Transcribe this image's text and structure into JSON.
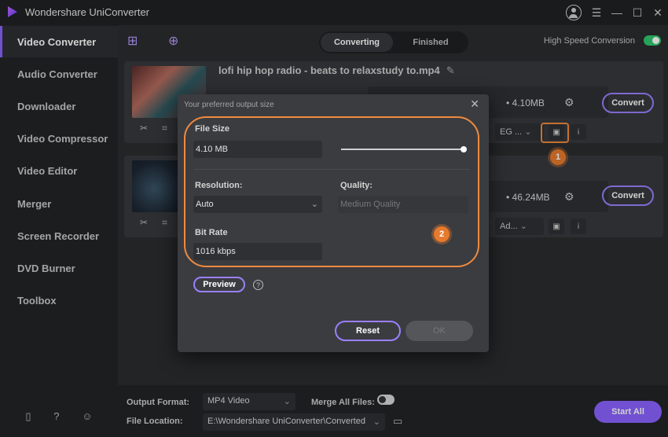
{
  "app": {
    "title": "Wondershare UniConverter"
  },
  "sidebar": {
    "items": [
      {
        "label": "Video Converter"
      },
      {
        "label": "Audio Converter"
      },
      {
        "label": "Downloader"
      },
      {
        "label": "Video Compressor"
      },
      {
        "label": "Video Editor"
      },
      {
        "label": "Merger"
      },
      {
        "label": "Screen Recorder"
      },
      {
        "label": "DVD Burner"
      },
      {
        "label": "Toolbox"
      }
    ]
  },
  "toolbar": {
    "tabs": [
      {
        "label": "Converting"
      },
      {
        "label": "Finished"
      }
    ],
    "high_speed_label": "High Speed Conversion"
  },
  "files": [
    {
      "title": "lofi hip hop radio - beats to relaxstudy to.mp4",
      "size": "• 4.10MB",
      "format": "EG ...",
      "convert_label": "Convert"
    },
    {
      "size": "• 46.24MB",
      "format": "Ad...",
      "convert_label": "Convert"
    }
  ],
  "dialog": {
    "title": "Your preferred output size",
    "file_size_label": "File Size",
    "file_size_value": "4.10 MB",
    "resolution_label": "Resolution:",
    "resolution_value": "Auto",
    "quality_label": "Quality:",
    "quality_value": "Medium Quality",
    "bitrate_label": "Bit Rate",
    "bitrate_value": "1016 kbps",
    "preview_label": "Preview",
    "reset_label": "Reset",
    "ok_label": "OK",
    "slider_fraction": 1.0
  },
  "annotations": {
    "badge1": "1",
    "badge2": "2"
  },
  "bottom": {
    "output_format_label": "Output Format:",
    "output_format_value": "MP4 Video",
    "merge_label": "Merge All Files:",
    "file_location_label": "File Location:",
    "file_location_value": "E:\\Wondershare UniConverter\\Converted",
    "start_all_label": "Start All"
  },
  "colors": {
    "accent": "#8a63ff",
    "highlight": "#f08a3e",
    "toggle_on": "#2fc76c"
  }
}
